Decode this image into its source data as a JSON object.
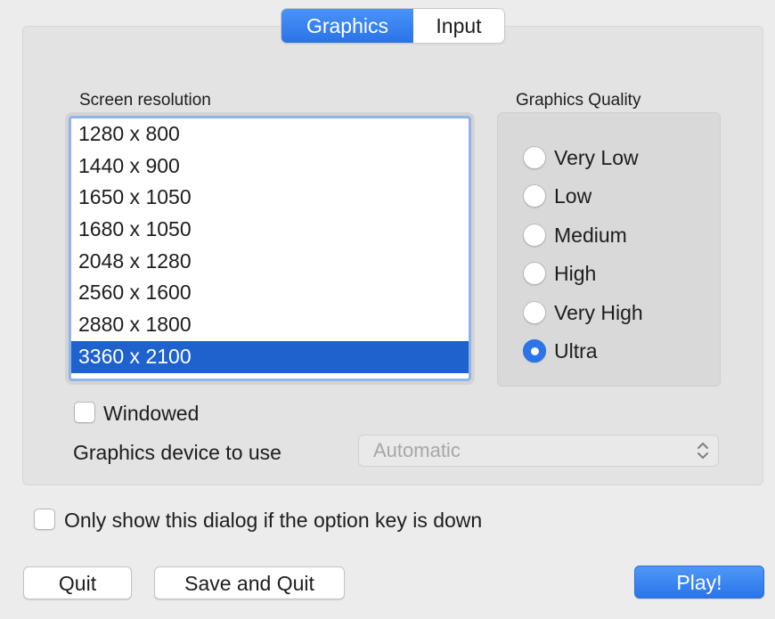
{
  "tabs": [
    {
      "label": "Graphics",
      "active": true
    },
    {
      "label": "Input",
      "active": false
    }
  ],
  "graphics": {
    "screen_resolution_label": "Screen resolution",
    "resolutions": [
      "1280 x 800",
      "1440 x 900",
      "1650 x 1050",
      "1680 x 1050",
      "2048 x 1280",
      "2560 x 1600",
      "2880 x 1800",
      "3360 x 2100"
    ],
    "selected_resolution": "3360 x 2100",
    "quality_label": "Graphics Quality",
    "quality_options": [
      "Very Low",
      "Low",
      "Medium",
      "High",
      "Very High",
      "Ultra"
    ],
    "selected_quality": "Ultra",
    "windowed_label": "Windowed",
    "windowed_checked": false,
    "device_label": "Graphics device to use",
    "device_value": "Automatic"
  },
  "option_key_label": "Only show this dialog if the option key is down",
  "option_key_checked": false,
  "buttons": {
    "quit": "Quit",
    "save_quit": "Save and Quit",
    "play": "Play!"
  },
  "colors": {
    "accent": "#2a74ea",
    "selection": "#1f62cd",
    "panel": "#e3e3e3"
  }
}
